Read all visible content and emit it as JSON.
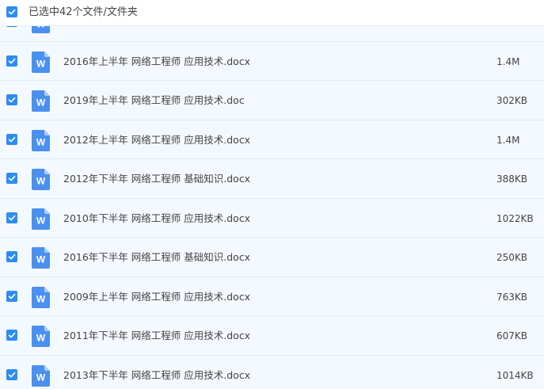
{
  "header": {
    "selection_text": "已选中42个文件/文件夹"
  },
  "file_icon_letter": "W",
  "files": [
    {
      "name": "",
      "size": ""
    },
    {
      "name": "2016年上半年 网络工程师 应用技术.docx",
      "size": "1.4M"
    },
    {
      "name": "2019年上半年 网络工程师 应用技术.doc",
      "size": "302KB"
    },
    {
      "name": "2012年上半年 网络工程师 应用技术.docx",
      "size": "1.4M"
    },
    {
      "name": "2012年下半年 网络工程师 基础知识.docx",
      "size": "388KB"
    },
    {
      "name": "2010年下半年 网络工程师 应用技术.docx",
      "size": "1022KB"
    },
    {
      "name": "2016年下半年 网络工程师 基础知识.docx",
      "size": "250KB"
    },
    {
      "name": "2009年上半年 网络工程师 应用技术.docx",
      "size": "763KB"
    },
    {
      "name": "2011年下半年 网络工程师 应用技术.docx",
      "size": "607KB"
    },
    {
      "name": "2013年下半年 网络工程师 应用技术.docx",
      "size": "1014KB"
    }
  ],
  "colors": {
    "accent": "#2d8cf0",
    "row_bg": "#f4f9ff",
    "divider": "#dfeaf6",
    "doc_icon": "#4a90f0"
  }
}
